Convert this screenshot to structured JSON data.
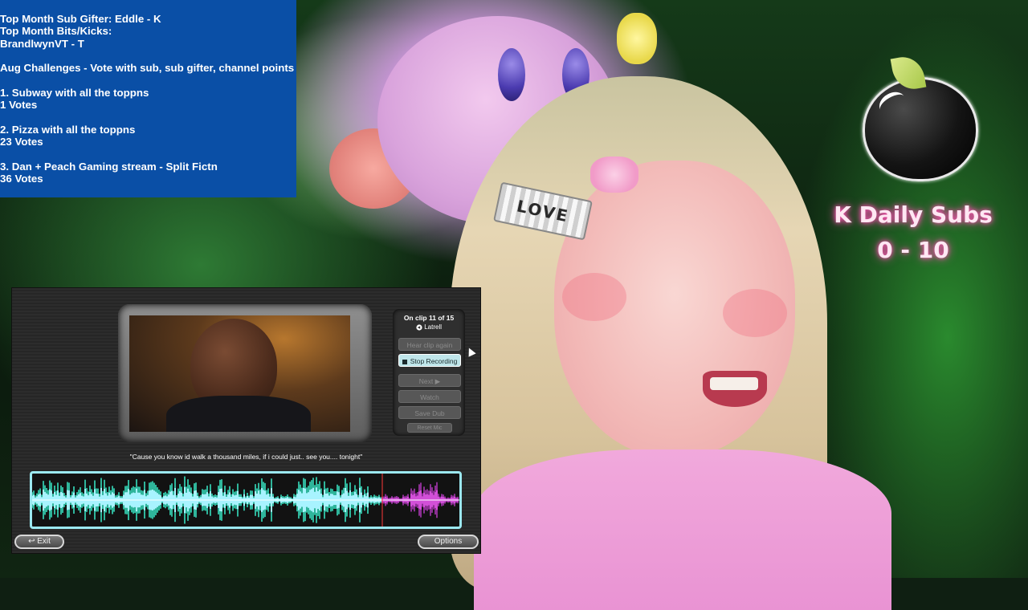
{
  "info_panel": {
    "lines": [
      "Top Month Sub Gifter:  Eddle - K",
      "Top Month Bits/Kicks:",
      "BrandlwynVT - T",
      "",
      "Aug Challenges - Vote with sub, sub gifter, channel points",
      "",
      "1. Subway with all the toppns",
      "1 Votes",
      "",
      "2. Pizza with all the toppns",
      "23 Votes",
      "",
      "3. Dan + Peach Gaming stream - Split Fictn",
      "36 Votes"
    ]
  },
  "overlay": {
    "daily_subs_label": "K Daily Subs",
    "daily_subs_count": "0 - 10",
    "love_clip_text": "LOVE"
  },
  "game": {
    "clip_status": "On clip 11 of 15",
    "speaker": "Latrell",
    "buttons": {
      "hear_clip_again": "Hear clip again",
      "stop_recording": "Stop Recording",
      "next": "Next ▶",
      "watch": "Watch",
      "save_dub": "Save Dub",
      "reset_mic": "Reset Mic"
    },
    "caption": "\"Cause you know id walk a thousand miles, if i could just.. see you.... tonight\"",
    "exit_label": "↩ Exit",
    "options_label": "Options"
  },
  "colors": {
    "info_panel_bg": "#0a4fa6",
    "neon_pink": "#ff4fb4",
    "waveform_cyan": "#9be8f0",
    "waveform_magenta": "#d24fd8",
    "active_button": "#bfe6ea"
  },
  "icons": {
    "speaker": "speaker-icon",
    "record": "record-square-icon",
    "exit": "back-arrow-icon",
    "cursor": "mouse-pointer-icon"
  }
}
